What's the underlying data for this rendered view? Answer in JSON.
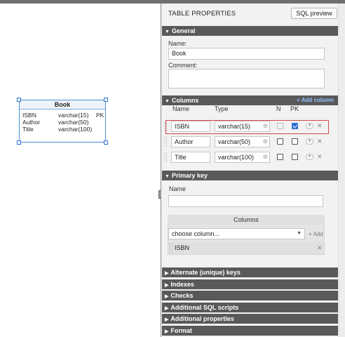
{
  "diagram": {
    "table_name": "Book",
    "rows": [
      {
        "name": "ISBN",
        "type": "varchar(15)",
        "key": "PK"
      },
      {
        "name": "Author",
        "type": "varchar(50)",
        "key": ""
      },
      {
        "name": "Title",
        "type": "varchar(100)",
        "key": ""
      }
    ]
  },
  "panel": {
    "title": "TABLE PROPERTIES",
    "sql_preview_label": "SQL preview",
    "general": {
      "section_label": "General",
      "name_label": "Name:",
      "name_value": "Book",
      "comment_label": "Comment:",
      "comment_value": ""
    },
    "columns": {
      "section_label": "Columns",
      "add_column_label": "+ Add column",
      "headers": {
        "name": "Name",
        "type": "Type",
        "n": "N",
        "pk": "PK"
      },
      "rows": [
        {
          "name": "ISBN",
          "type": "varchar(15)",
          "nullable": false,
          "pk": true,
          "selected": true
        },
        {
          "name": "Author",
          "type": "varchar(50)",
          "nullable": false,
          "pk": false,
          "selected": false
        },
        {
          "name": "Title",
          "type": "varchar(100)",
          "nullable": false,
          "pk": false,
          "selected": false
        }
      ]
    },
    "primary_key": {
      "section_label": "Primary key",
      "name_label": "Name",
      "name_value": "",
      "columns_label": "Columns",
      "choose_placeholder": "choose column...",
      "add_label": "+ Add",
      "items": [
        "ISBN"
      ]
    },
    "collapsed_sections": [
      "Alternate (unique) keys",
      "Indexes",
      "Checks",
      "Additional SQL scripts",
      "Additional properties",
      "Format"
    ]
  },
  "icons": {
    "expanded": "triangle-down-icon",
    "collapsed": "triangle-right-icon",
    "gear": "gear-icon",
    "remove": "close-icon",
    "dropdown": "chevron-down-icon"
  },
  "colors": {
    "section_bg": "#595959",
    "selection_border": "#d24a4a",
    "table_border": "#4a90d9",
    "add_link": "#8fc3ff",
    "checkbox_checked": "#2f6fd1"
  }
}
